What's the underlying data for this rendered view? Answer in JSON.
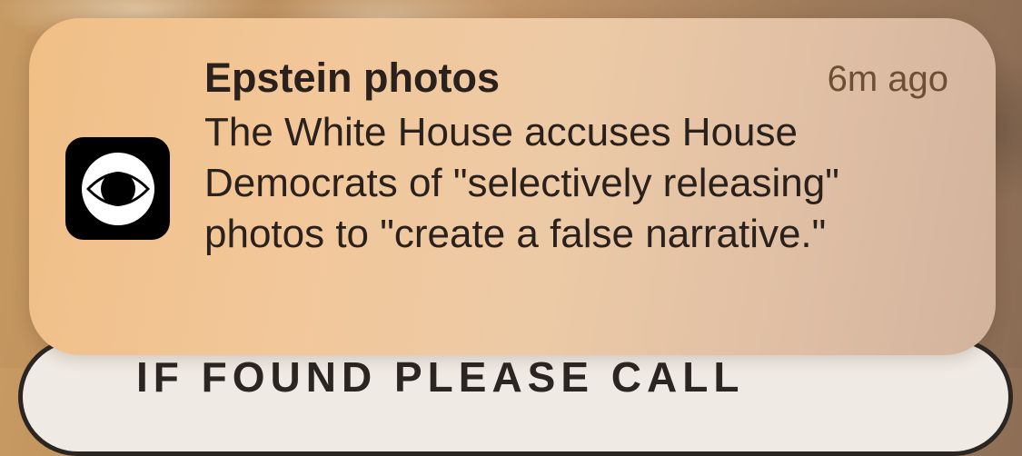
{
  "background": {
    "tag_text": "IF FOUND PLEASE CALL"
  },
  "notification": {
    "app_icon": "cbs-eye-icon",
    "title": "Epstein photos",
    "time": "6m ago",
    "body": "The White House accuses House Democrats of \"selectively releasing\" photos to \"create a false narrative.\"",
    "colors": {
      "title": "#2a211c",
      "time": "#6e4f33",
      "icon_background": "#000000"
    }
  }
}
